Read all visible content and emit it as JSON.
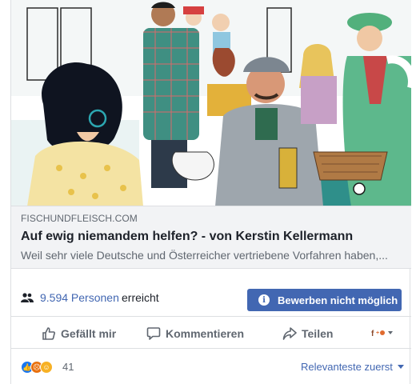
{
  "post": {
    "link_domain": "FISCHUNDFLEISCH.COM",
    "link_title": "Auf ewig niemandem helfen? - von Kerstin Kellermann",
    "link_description": "Weil sehr viele Deutsche und Österreicher vertriebene Vorfahren haben,..."
  },
  "reach": {
    "count_label": "9.594 Personen",
    "suffix": "erreicht",
    "people_icon": "people-icon"
  },
  "boost": {
    "label": "Bewerben nicht möglich",
    "icon": "info-icon"
  },
  "actions": {
    "like": "Gefällt mir",
    "comment": "Kommentieren",
    "share": "Teilen",
    "audience_icon": "audience-selector-icon"
  },
  "reactions": {
    "types": [
      "like",
      "angry",
      "haha"
    ],
    "count": "41",
    "sort_label": "Relevanteste zuerst"
  },
  "colors": {
    "link_blue": "#4267b2",
    "text_dark": "#1d2129",
    "text_muted": "#606770",
    "meta_bg": "#f2f3f5",
    "border": "#dddfe2"
  }
}
